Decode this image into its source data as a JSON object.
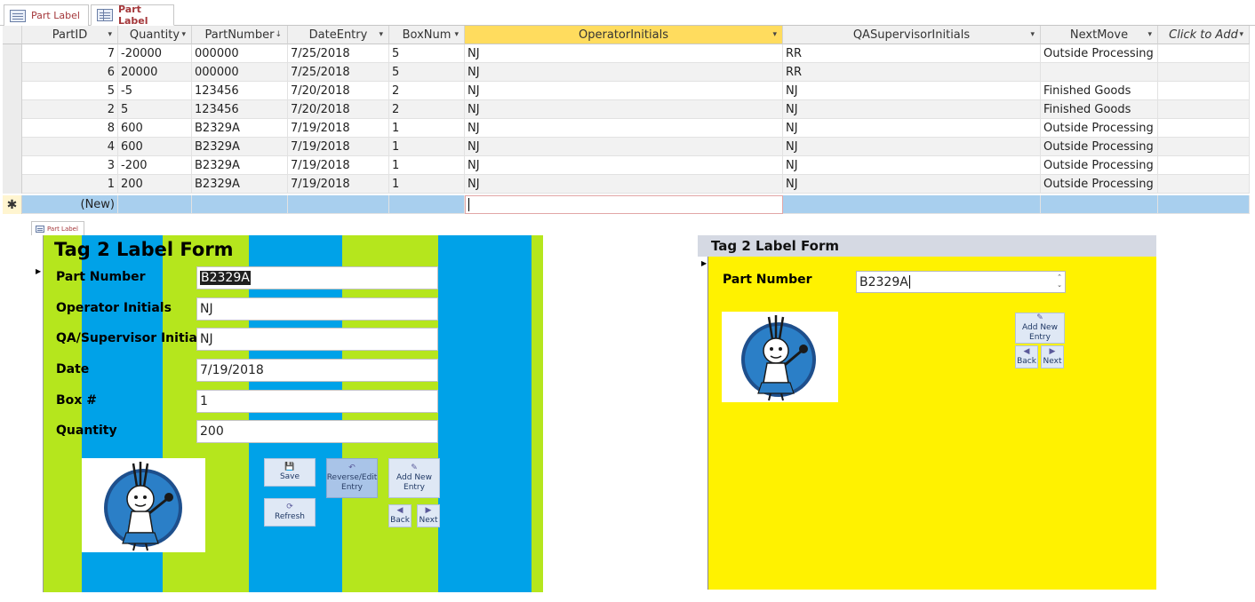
{
  "tabs": [
    {
      "label": "Part Label",
      "icon": "form-icon"
    },
    {
      "label": "Part Label",
      "icon": "datasheet-icon"
    }
  ],
  "datasheet": {
    "columns": [
      "PartID",
      "Quantity",
      "PartNumber",
      "DateEntry",
      "BoxNum",
      "OperatorInitials",
      "QASupervisorInitials",
      "NextMove",
      "Click to Add"
    ],
    "active_column": "OperatorInitials",
    "rows": [
      {
        "PartID": "7",
        "Quantity": "-20000",
        "PartNumber": "000000",
        "DateEntry": "7/25/2018",
        "BoxNum": "5",
        "OperatorInitials": "NJ",
        "QASupervisorInitials": "RR",
        "NextMove": "Outside Processing"
      },
      {
        "PartID": "6",
        "Quantity": "20000",
        "PartNumber": "000000",
        "DateEntry": "7/25/2018",
        "BoxNum": "5",
        "OperatorInitials": "NJ",
        "QASupervisorInitials": "RR",
        "NextMove": ""
      },
      {
        "PartID": "5",
        "Quantity": "-5",
        "PartNumber": "123456",
        "DateEntry": "7/20/2018",
        "BoxNum": "2",
        "OperatorInitials": "NJ",
        "QASupervisorInitials": "NJ",
        "NextMove": "Finished Goods"
      },
      {
        "PartID": "2",
        "Quantity": "5",
        "PartNumber": "123456",
        "DateEntry": "7/20/2018",
        "BoxNum": "2",
        "OperatorInitials": "NJ",
        "QASupervisorInitials": "NJ",
        "NextMove": "Finished Goods"
      },
      {
        "PartID": "8",
        "Quantity": "600",
        "PartNumber": "B2329A",
        "DateEntry": "7/19/2018",
        "BoxNum": "1",
        "OperatorInitials": "NJ",
        "QASupervisorInitials": "NJ",
        "NextMove": "Outside Processing"
      },
      {
        "PartID": "4",
        "Quantity": "600",
        "PartNumber": "B2329A",
        "DateEntry": "7/19/2018",
        "BoxNum": "1",
        "OperatorInitials": "NJ",
        "QASupervisorInitials": "NJ",
        "NextMove": "Outside Processing"
      },
      {
        "PartID": "3",
        "Quantity": "-200",
        "PartNumber": "B2329A",
        "DateEntry": "7/19/2018",
        "BoxNum": "1",
        "OperatorInitials": "NJ",
        "QASupervisorInitials": "NJ",
        "NextMove": "Outside Processing"
      },
      {
        "PartID": "1",
        "Quantity": "200",
        "PartNumber": "B2329A",
        "DateEntry": "7/19/2018",
        "BoxNum": "1",
        "OperatorInitials": "NJ",
        "QASupervisorInitials": "NJ",
        "NextMove": "Outside Processing"
      }
    ],
    "new_row_label": "(New)",
    "new_row_marker": "✱"
  },
  "form1": {
    "tab_label": "Part Label",
    "title": "Tag 2 Label Form",
    "fields": [
      {
        "label": "Part Number",
        "value": "B2329A"
      },
      {
        "label": "Operator Initials",
        "value": "NJ"
      },
      {
        "label": "QA/Supervisor Initials",
        "value": "NJ"
      },
      {
        "label": "Date",
        "value": "7/19/2018"
      },
      {
        "label": "Box #",
        "value": "1"
      },
      {
        "label": "Quantity",
        "value": "200"
      }
    ],
    "buttons": {
      "save": "Save",
      "refresh": "Refresh",
      "reverse_edit": "Reverse/Edit Entry",
      "add_new": "Add New Entry",
      "back": "Back",
      "next": "Next"
    },
    "colors": {
      "green": "#b5e61d",
      "blue": "#00a2e8"
    }
  },
  "form2": {
    "title": "Tag 2 Label Form",
    "field_label": "Part Number",
    "field_value": "B2329A",
    "buttons": {
      "add_new": "Add New Entry",
      "back": "Back",
      "next": "Next"
    },
    "colors": {
      "background": "#fff200",
      "header": "#d5d9e3"
    }
  }
}
